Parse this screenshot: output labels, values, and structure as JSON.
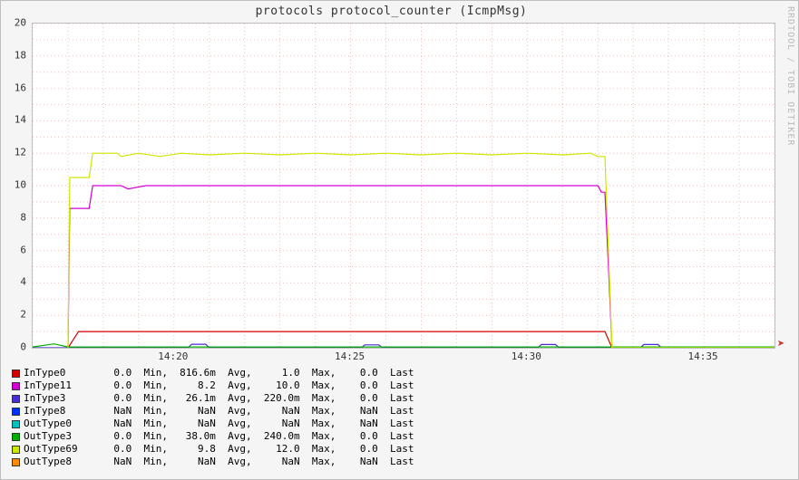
{
  "title": "protocols protocol_counter (IcmpMsg)",
  "watermark": "RRDTOOL / TOBI OETIKER",
  "chart_data": {
    "type": "line",
    "ylim": [
      0,
      20
    ],
    "yticks": [
      0,
      2,
      4,
      6,
      8,
      10,
      12,
      14,
      16,
      18,
      20
    ],
    "x_time_ticks": [
      "14:20",
      "14:25",
      "14:30",
      "14:35"
    ],
    "x_range_minutes": [
      0,
      21
    ],
    "series": [
      {
        "name": "InType0",
        "color": "#d40000",
        "stats": {
          "min": "0.0",
          "avg": "816.6m",
          "max": "1.0",
          "last": "0.0"
        },
        "points": [
          [
            1.0,
            0.0
          ],
          [
            1.3,
            1.0
          ],
          [
            16.2,
            1.0
          ],
          [
            16.4,
            0.0
          ],
          [
            21.0,
            0.0
          ]
        ]
      },
      {
        "name": "InType11",
        "color": "#d400d4",
        "stats": {
          "min": "0.0",
          "avg": "8.2",
          "max": "10.0",
          "last": "0.0"
        },
        "points": [
          [
            1.0,
            0.0
          ],
          [
            1.05,
            8.6
          ],
          [
            1.6,
            8.6
          ],
          [
            1.7,
            10.0
          ],
          [
            2.5,
            10.0
          ],
          [
            2.7,
            9.8
          ],
          [
            3.2,
            10.0
          ],
          [
            16.0,
            10.0
          ],
          [
            16.1,
            9.6
          ],
          [
            16.2,
            9.6
          ],
          [
            16.3,
            5.0
          ],
          [
            16.4,
            0.0
          ],
          [
            21.0,
            0.0
          ]
        ]
      },
      {
        "name": "InType3",
        "color": "#4a2bd6",
        "stats": {
          "min": "0.0",
          "avg": "26.1m",
          "max": "220.0m",
          "last": "0.0"
        },
        "points": [
          [
            0.0,
            0.0
          ],
          [
            4.4,
            0.0
          ],
          [
            4.5,
            0.22
          ],
          [
            4.9,
            0.22
          ],
          [
            5.0,
            0.0
          ],
          [
            9.3,
            0.0
          ],
          [
            9.4,
            0.18
          ],
          [
            9.8,
            0.18
          ],
          [
            9.9,
            0.0
          ],
          [
            14.3,
            0.0
          ],
          [
            14.4,
            0.2
          ],
          [
            14.8,
            0.2
          ],
          [
            14.9,
            0.0
          ],
          [
            17.2,
            0.0
          ],
          [
            17.3,
            0.2
          ],
          [
            17.7,
            0.2
          ],
          [
            17.8,
            0.0
          ],
          [
            21.0,
            0.0
          ]
        ]
      },
      {
        "name": "InType8",
        "color": "#0030ff",
        "stats": {
          "min": "NaN",
          "avg": "NaN",
          "max": "NaN",
          "last": "NaN"
        },
        "points": []
      },
      {
        "name": "OutType0",
        "color": "#00c0c0",
        "stats": {
          "min": "NaN",
          "avg": "NaN",
          "max": "NaN",
          "last": "NaN"
        },
        "points": []
      },
      {
        "name": "OutType3",
        "color": "#00b000",
        "stats": {
          "min": "0.0",
          "avg": "38.0m",
          "max": "240.0m",
          "last": "0.0"
        },
        "points": [
          [
            0.0,
            0.05
          ],
          [
            0.6,
            0.24
          ],
          [
            1.0,
            0.05
          ],
          [
            21.0,
            0.05
          ]
        ]
      },
      {
        "name": "OutType69",
        "color": "#cfe600",
        "stats": {
          "min": "0.0",
          "avg": "9.8",
          "max": "12.0",
          "last": "0.0"
        },
        "points": [
          [
            1.0,
            0.0
          ],
          [
            1.05,
            10.5
          ],
          [
            1.6,
            10.5
          ],
          [
            1.7,
            12.0
          ],
          [
            2.4,
            12.0
          ],
          [
            2.5,
            11.8
          ],
          [
            3.0,
            12.0
          ],
          [
            3.6,
            11.8
          ],
          [
            4.2,
            12.0
          ],
          [
            5.0,
            11.9
          ],
          [
            6.0,
            12.0
          ],
          [
            7.0,
            11.9
          ],
          [
            8.0,
            12.0
          ],
          [
            9.0,
            11.9
          ],
          [
            10.0,
            12.0
          ],
          [
            11.0,
            11.9
          ],
          [
            12.0,
            12.0
          ],
          [
            13.0,
            11.9
          ],
          [
            14.0,
            12.0
          ],
          [
            15.0,
            11.9
          ],
          [
            15.8,
            12.0
          ],
          [
            16.0,
            11.8
          ],
          [
            16.2,
            11.8
          ],
          [
            16.35,
            3.0
          ],
          [
            16.4,
            0.0
          ],
          [
            21.0,
            0.0
          ]
        ]
      },
      {
        "name": "OutType8",
        "color": "#ff8c00",
        "stats": {
          "min": "NaN",
          "avg": "NaN",
          "max": "NaN",
          "last": "NaN"
        },
        "points": []
      }
    ]
  },
  "legend_cols": {
    "min": "Min,",
    "avg": "Avg,",
    "max": "Max,",
    "last": "Last"
  }
}
